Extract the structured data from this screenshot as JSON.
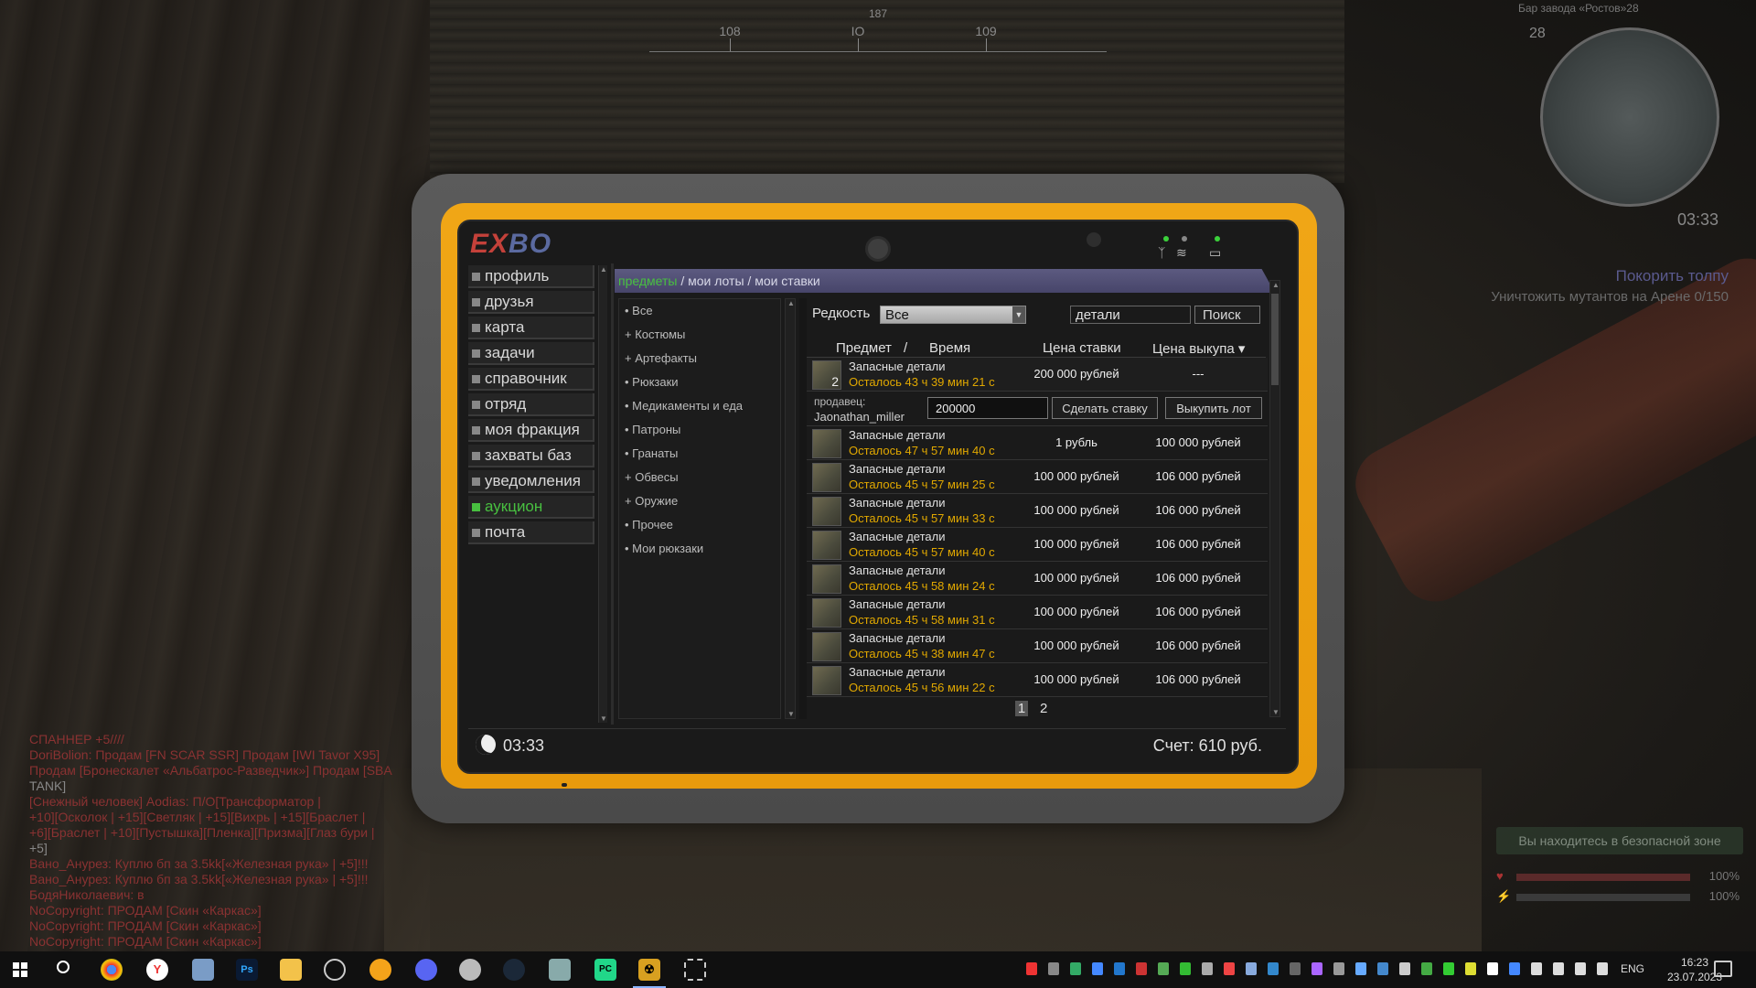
{
  "hud": {
    "compass": {
      "bearing": "187",
      "labels": [
        "108",
        "IO",
        "109"
      ]
    },
    "minimap": {
      "location": "Бар завода «Ростов»28",
      "level": "28",
      "time": "03:33"
    },
    "quest": {
      "title": "Покорить толпу",
      "subtitle": "Уничтожить мутантов на Арене 0/150"
    },
    "safe_zone": "Вы находитесь в безопасной зоне",
    "health": "100%",
    "stamina": "100%"
  },
  "chat": [
    {
      "text": "СПАННЕР +5////",
      "style": "red"
    },
    {
      "text": "DoriBolion: Продам [FN SCAR SSR] Продам [IWI Tavor X95]",
      "style": "red"
    },
    {
      "text": "Продам [Бронескалет «Альбатрос-Разведчик»] Продам [SBA",
      "style": "red"
    },
    {
      "text": "TANK]",
      "style": "grey"
    },
    {
      "text": "[Снежный человек] Aodias: П/О[Трансформатор |",
      "style": "red"
    },
    {
      "text": "+10][Осколок | +15][Светляк | +15][Вихрь | +15][Браслет |",
      "style": "red"
    },
    {
      "text": "+6][Браслет | +10][Пустышка][Пленка][Призма][Глаз бури |",
      "style": "red"
    },
    {
      "text": "+5]",
      "style": "grey"
    },
    {
      "text": "Вано_Анурез: Куплю бп за 3.5kk[«Железная рука» | +5]!!!",
      "style": "red"
    },
    {
      "text": "Вано_Анурез: Куплю бп за 3.5kk[«Железная рука» | +5]!!!",
      "style": "red"
    },
    {
      "text": "БодяНиколаевич: в",
      "style": "red"
    },
    {
      "text": "NoCopyright: ПРОДАМ [Скин «Каркас»]",
      "style": "red"
    },
    {
      "text": "NoCopyright: ПРОДАМ [Скин «Каркас»]",
      "style": "red"
    },
    {
      "text": "NoCopyright: ПРОДАМ [Скин «Каркас»]",
      "style": "red"
    }
  ],
  "pda": {
    "logo_a": "E",
    "logo_x": "X",
    "logo_b": "BO",
    "nav": [
      {
        "label": "профиль"
      },
      {
        "label": "друзья"
      },
      {
        "label": "карта"
      },
      {
        "label": "задачи"
      },
      {
        "label": "справочник"
      },
      {
        "label": "отряд"
      },
      {
        "label": "моя фракция"
      },
      {
        "label": "захваты баз"
      },
      {
        "label": "уведомления"
      },
      {
        "label": "аукцион",
        "active": true
      },
      {
        "label": "почта"
      }
    ],
    "breadcrumb": {
      "items": "предметы",
      "my_lots": "мои лоты",
      "my_bids": "мои ставки",
      "sep": "/"
    },
    "categories": [
      "• Все",
      "+ Костюмы",
      "+ Артефакты",
      "• Рюкзаки",
      "• Медикаменты и еда",
      "• Патроны",
      "• Гранаты",
      "+ Обвесы",
      "+ Оружие",
      "• Прочее",
      "• Мои рюкзаки"
    ],
    "filter": {
      "rarity_label": "Редкость",
      "rarity_value": "Все",
      "search_value": "детали",
      "search_button": "Поиск"
    },
    "table": {
      "headers": {
        "item": "Предмет",
        "sep": "/",
        "time": "Время",
        "bid": "Цена ставки",
        "buyout": "Цена выкупа ▾"
      },
      "selected": {
        "name": "Запасные детали",
        "qty": "2",
        "time": "Осталось 43 ч 39 мин 21 с",
        "bid": "200 000 рублей",
        "buyout": "---",
        "seller_label": "продавец:",
        "seller_name": "Jaonathan_miller",
        "bid_input": "200000",
        "bid_button": "Сделать ставку",
        "buyout_button": "Выкупить лот"
      },
      "rows": [
        {
          "name": "Запасные детали",
          "time": "Осталось 47 ч 57 мин 40 с",
          "bid": "1 рубль",
          "buyout": "100 000 рублей"
        },
        {
          "name": "Запасные детали",
          "time": "Осталось 45 ч 57 мин 25 с",
          "bid": "100 000 рублей",
          "buyout": "106 000 рублей"
        },
        {
          "name": "Запасные детали",
          "time": "Осталось 45 ч 57 мин 33 с",
          "bid": "100 000 рублей",
          "buyout": "106 000 рублей"
        },
        {
          "name": "Запасные детали",
          "time": "Осталось 45 ч 57 мин 40 с",
          "bid": "100 000 рублей",
          "buyout": "106 000 рублей"
        },
        {
          "name": "Запасные детали",
          "time": "Осталось 45 ч 58 мин 24 с",
          "bid": "100 000 рублей",
          "buyout": "106 000 рублей"
        },
        {
          "name": "Запасные детали",
          "time": "Осталось 45 ч 58 мин 31 с",
          "bid": "100 000 рублей",
          "buyout": "106 000 рублей"
        },
        {
          "name": "Запасные детали",
          "time": "Осталось 45 ч 38 мин 47 с",
          "bid": "100 000 рублей",
          "buyout": "106 000 рублей"
        },
        {
          "name": "Запасные детали",
          "time": "Осталось 45 ч 56 мин 22 с",
          "bid": "100 000 рублей",
          "buyout": "106 000 рублей"
        }
      ]
    },
    "pager": [
      "1",
      "2"
    ],
    "footer": {
      "clock": "03:33",
      "account": "Счет: 610 руб."
    }
  },
  "taskbar": {
    "lang": "ENG",
    "time": "16:23",
    "date": "23.07.2023"
  }
}
